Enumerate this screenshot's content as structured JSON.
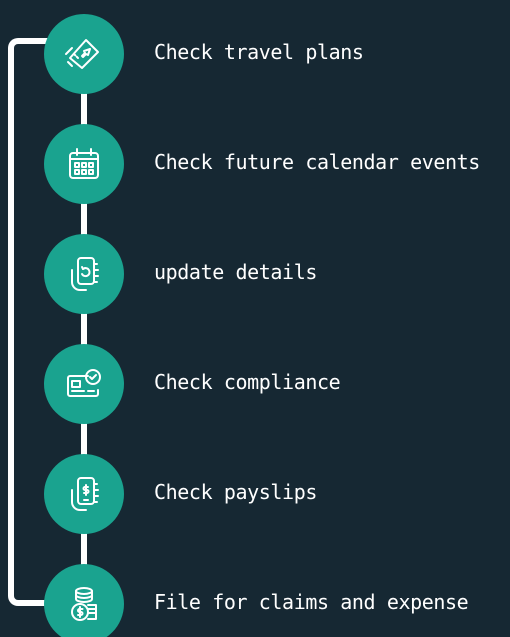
{
  "colors": {
    "background": "#162833",
    "accent": "#1aa38f",
    "line": "#ffffff",
    "text": "#ffffff"
  },
  "steps": [
    {
      "label": "Check travel plans",
      "icon": "travel-ticket-icon"
    },
    {
      "label": "Check future calendar events",
      "icon": "calendar-icon"
    },
    {
      "label": "update details",
      "icon": "phone-update-icon"
    },
    {
      "label": "Check compliance",
      "icon": "compliance-card-icon"
    },
    {
      "label": "Check payslips",
      "icon": "phone-payslip-icon"
    },
    {
      "label": "File for claims and expense",
      "icon": "coins-claim-icon"
    }
  ]
}
